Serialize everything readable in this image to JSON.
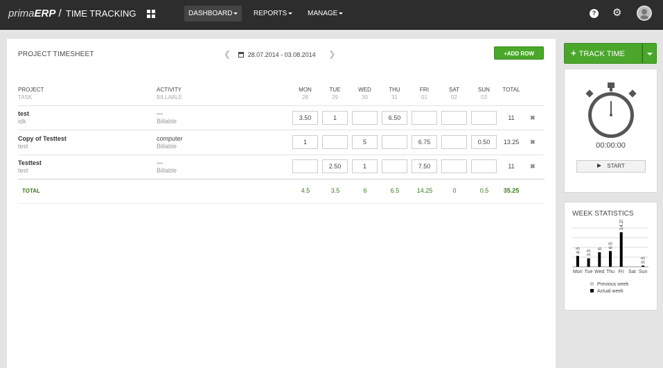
{
  "header": {
    "brand_prima": "prima",
    "brand_erp": "ERP",
    "brand_sep": " / ",
    "brand_app": "TIME TRACKING",
    "nav": [
      {
        "label": "DASHBOARD",
        "active": true
      },
      {
        "label": "REPORTS",
        "active": false
      },
      {
        "label": "MANAGE",
        "active": false
      }
    ],
    "help_icon": "help-icon",
    "settings_icon": "gear-icon",
    "user_icon": "user-avatar-icon"
  },
  "timesheet": {
    "title": "PROJECT TIMESHEET",
    "date_range": "28.07.2014 - 03.08.2014",
    "add_row_label": "ADD ROW",
    "columns": {
      "project": "PROJECT",
      "task": "TASK",
      "activity": "ACTIVITY",
      "billable": "BILLABLE",
      "total": "TOTAL"
    },
    "days": [
      {
        "name": "MON",
        "date": "28"
      },
      {
        "name": "TUE",
        "date": "29"
      },
      {
        "name": "WED",
        "date": "30"
      },
      {
        "name": "THU",
        "date": "31"
      },
      {
        "name": "FRI",
        "date": "01"
      },
      {
        "name": "SAT",
        "date": "02"
      },
      {
        "name": "SUN",
        "date": "03"
      }
    ],
    "rows": [
      {
        "project": "test",
        "task": "idk",
        "activity": "---",
        "billable": "Billable",
        "hours": [
          "3.50",
          "1",
          "",
          "6.50",
          "",
          "",
          ""
        ],
        "total": "11"
      },
      {
        "project": "Copy of Testtest",
        "task": "test",
        "activity": "computer",
        "billable": "Billable",
        "hours": [
          "1",
          "",
          "5",
          "",
          "6.75",
          "",
          "0.50"
        ],
        "total": "13.25"
      },
      {
        "project": "Testtest",
        "task": "test",
        "activity": "---",
        "billable": "Billable",
        "hours": [
          "",
          "2.50",
          "1",
          "",
          "7.50",
          "",
          ""
        ],
        "total": "11"
      }
    ],
    "totals": {
      "label": "TOTAL",
      "days": [
        "4.5",
        "3.5",
        "6",
        "6.5",
        "14.25",
        "0",
        "0.5"
      ],
      "grand": "35.25"
    }
  },
  "tracker": {
    "button_label": "TRACK TIME",
    "time": "00:00:00",
    "start_label": "START"
  },
  "week_stats": {
    "title": "WEEK STATISTICS",
    "legend_previous": "Previous week",
    "legend_actual": "Actual week",
    "colors": {
      "previous": "#cccccc",
      "actual": "#000000"
    }
  },
  "chart_data": {
    "type": "bar",
    "categories": [
      "Mon",
      "Tue",
      "Wed",
      "Thu",
      "Fri",
      "Sat",
      "Sun"
    ],
    "series": [
      {
        "name": "Actual week",
        "values": [
          4.5,
          3.5,
          6,
          6.5,
          14.25,
          0,
          0.5
        ]
      }
    ],
    "data_labels": [
      "4.5",
      "3.5",
      "6",
      "6.5",
      "14.25",
      "",
      "0.5"
    ],
    "ylim": [
      0,
      16
    ],
    "grid": true
  }
}
